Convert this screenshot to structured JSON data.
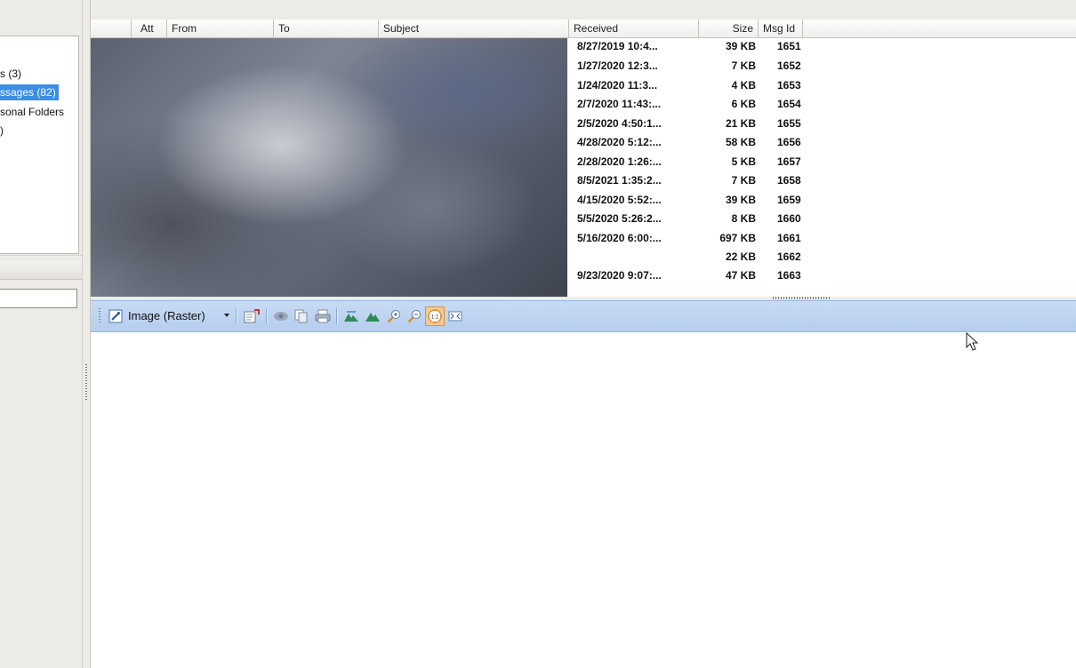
{
  "folders": [
    {
      "label": "s (3)",
      "selected": false
    },
    {
      "label": "ssages (82)",
      "selected": true
    },
    {
      "label": "sonal Folders",
      "selected": false
    },
    {
      "label": ")",
      "selected": false
    }
  ],
  "columns": {
    "att": "Att",
    "from": "From",
    "to": "To",
    "subject": "Subject",
    "received": "Received",
    "size": "Size",
    "msg_id": "Msg Id"
  },
  "messages": [
    {
      "received": "8/27/2019 10:4...",
      "size": "39 KB",
      "msg_id": "1651"
    },
    {
      "received": "1/27/2020 12:3...",
      "size": "7 KB",
      "msg_id": "1652"
    },
    {
      "received": "1/24/2020 11:3...",
      "size": "4 KB",
      "msg_id": "1653"
    },
    {
      "received": "2/7/2020 11:43:...",
      "size": "6 KB",
      "msg_id": "1654"
    },
    {
      "received": "2/5/2020 4:50:1...",
      "size": "21 KB",
      "msg_id": "1655"
    },
    {
      "received": "4/28/2020 5:12:...",
      "size": "58 KB",
      "msg_id": "1656"
    },
    {
      "received": "2/28/2020 1:26:...",
      "size": "5 KB",
      "msg_id": "1657"
    },
    {
      "received": "8/5/2021 1:35:2...",
      "size": "7 KB",
      "msg_id": "1658"
    },
    {
      "received": "4/15/2020 5:52:...",
      "size": "39 KB",
      "msg_id": "1659"
    },
    {
      "received": "5/5/2020 5:26:2...",
      "size": "8 KB",
      "msg_id": "1660"
    },
    {
      "received": "5/16/2020 6:00:...",
      "size": "697 KB",
      "msg_id": "1661"
    },
    {
      "received": "",
      "size": "22 KB",
      "msg_id": "1662"
    },
    {
      "received": "9/23/2020 9:07:...",
      "size": "47 KB",
      "msg_id": "1663"
    }
  ],
  "viewer_toolbar": {
    "mode_label": "Image (Raster)",
    "icons": [
      "properties-icon",
      "view-icon",
      "copy-icon",
      "print-icon",
      "flip-horizontal-icon",
      "flip-vertical-icon",
      "zoom-in-icon",
      "zoom-out-icon",
      "actual-size-icon",
      "fit-to-window-icon"
    ],
    "active_icon": "actual-size-icon",
    "actual_size_text": "1:1"
  },
  "colors": {
    "selection": "#3c8ee3",
    "toolbar": "#bfd5f2",
    "active_button": "#f7c98d"
  }
}
